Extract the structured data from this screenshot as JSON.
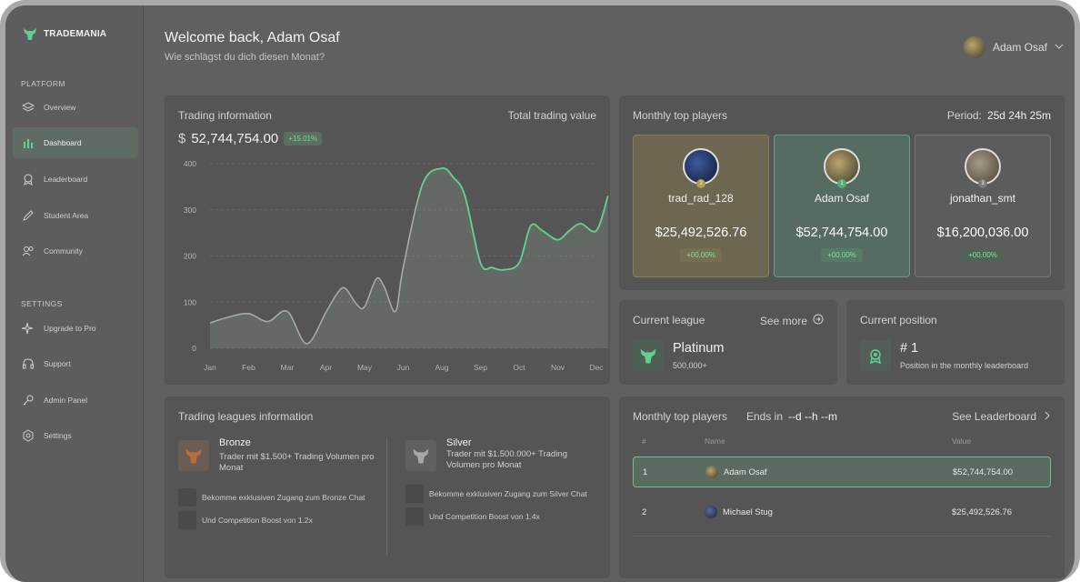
{
  "brand": {
    "name": "TRADEMANIA"
  },
  "sidebar": {
    "platform_label": "PLATFORM",
    "settings_label": "SETTINGS",
    "items": [
      {
        "label": "Overview",
        "icon": "layers-icon"
      },
      {
        "label": "Dashboard",
        "icon": "bar-chart-icon",
        "active": true
      },
      {
        "label": "Leaderboard",
        "icon": "award-icon"
      },
      {
        "label": "Student Area",
        "icon": "pencil-icon"
      },
      {
        "label": "Community",
        "icon": "users-icon"
      }
    ],
    "settings_items": [
      {
        "label": "Upgrade to Pro",
        "icon": "sparkle-icon"
      },
      {
        "label": "Support",
        "icon": "headset-icon"
      },
      {
        "label": "Admin Panel",
        "icon": "key-icon"
      },
      {
        "label": "Settings",
        "icon": "hexagon-gear-icon"
      }
    ]
  },
  "header": {
    "welcome": "Welcome back, Adam Osaf",
    "subtitle": "Wie schlägst du dich diesen Monat?",
    "user_name": "Adam Osaf"
  },
  "trading": {
    "title": "Trading information",
    "total_label": "Total trading value",
    "currency": "$",
    "amount": "52,744,754.00",
    "change": "+15.01%"
  },
  "chart_data": {
    "type": "area",
    "categories": [
      "Jan",
      "Feb",
      "Mar",
      "Apr",
      "May",
      "Jun",
      "Aug",
      "Sep",
      "Oct",
      "Nov",
      "Dec"
    ],
    "x": [
      0,
      0.5,
      1,
      1.5,
      2,
      2.5,
      3,
      3.3,
      3.5,
      3.8,
      4,
      4.3,
      4.5,
      4.8,
      5,
      5.5,
      6,
      6.3,
      6.6,
      7,
      7.3,
      7.6,
      8,
      8.3,
      8.6,
      9,
      9.3,
      9.6,
      10,
      10.3
    ],
    "values": [
      55,
      68,
      75,
      58,
      80,
      10,
      78,
      120,
      130,
      95,
      90,
      150,
      135,
      80,
      175,
      355,
      390,
      370,
      330,
      185,
      175,
      170,
      185,
      265,
      255,
      235,
      255,
      270,
      255,
      330
    ],
    "ylim": [
      0,
      400
    ],
    "yticks": [
      "400",
      "300",
      "200",
      "100",
      "0"
    ],
    "grid": true,
    "line_color": "#5fd08f"
  },
  "top_players": {
    "title": "Monthly top players",
    "period_label": "Period:",
    "period_value": "25d 24h 25m",
    "players": [
      {
        "rank": "2",
        "name": "trad_rad_128",
        "value": "$25,492,526.76",
        "change": "+00.00%",
        "bg": "#6d6651",
        "border": "#8b7e57",
        "badge": "#77704f"
      },
      {
        "rank": "1",
        "name": "Adam Osaf",
        "value": "$52,744,754.00",
        "change": "+00.00%",
        "bg": "#566b61",
        "border": "#6d9a84",
        "badge": "#577a66"
      },
      {
        "rank": "3",
        "name": "jonathan_smt",
        "value": "$16,200,036.00",
        "change": "+00.00%",
        "bg": "#5c5c5c",
        "border": "#767676",
        "badge": "#516357"
      }
    ]
  },
  "league": {
    "title": "Current league",
    "see_more": "See more",
    "name": "Platinum",
    "count": "500,000+"
  },
  "position": {
    "title": "Current position",
    "rank": "# 1",
    "description": "Position in the monthly leaderboard"
  },
  "leagues_info": {
    "title": "Trading leagues information",
    "items": [
      {
        "name": "Bronze",
        "description": "Trader mit $1.500+ Trading Volumen pro Monat",
        "perks": [
          "Bekomme exklusiven Zugang zum Bronze Chat",
          "Und Competition Boost von 1.2x"
        ]
      },
      {
        "name": "Silver",
        "description": "Trader mit $1.500.000+ Trading Volumen pro Monat",
        "perks": [
          "Bekomme exklusiven Zugang zum Silver Chat",
          "Und Competition Boost von 1.4x"
        ]
      }
    ]
  },
  "leaderboard": {
    "title": "Monthly top players",
    "ends_label": "Ends in",
    "ends_value": "--d --h --m",
    "see_link": "See Leaderboard",
    "headers": [
      "#",
      "Name",
      "Value"
    ],
    "rows": [
      {
        "rank": "1",
        "name": "Adam Osaf",
        "value": "$52,744,754.00"
      },
      {
        "rank": "2",
        "name": "Michael Stug",
        "value": "$25,492,526.76"
      }
    ]
  }
}
